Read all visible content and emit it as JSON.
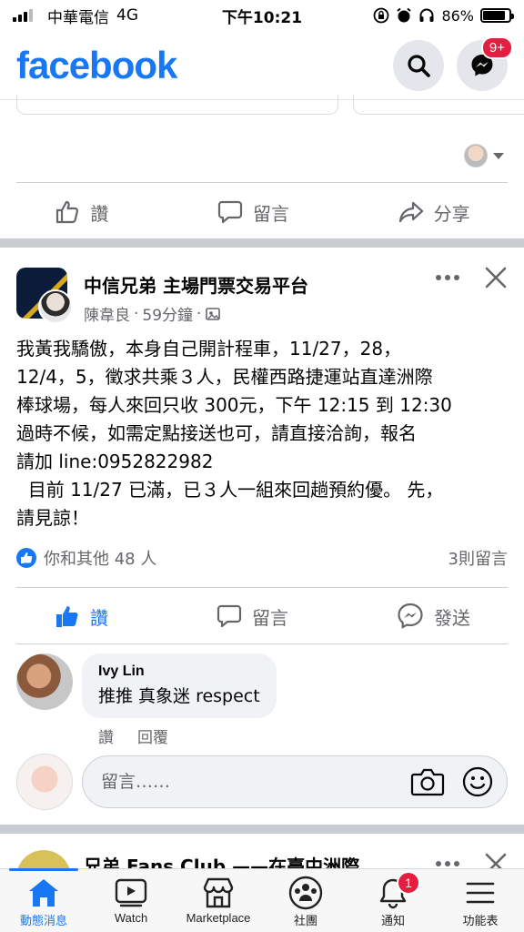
{
  "status_bar": {
    "carrier": "中華電信",
    "network": "4G",
    "time": "下午10:21",
    "battery": "86%",
    "battery_level": 0.86
  },
  "header": {
    "logo": "facebook",
    "messenger_badge": "9+"
  },
  "prev_post": {
    "actions": {
      "like": "讚",
      "comment": "留言",
      "share": "分享"
    }
  },
  "post": {
    "group_name": "中信兄弟 主場門票交易平台",
    "author": "陳韋良",
    "time": "59分鐘",
    "body": "我黃我驕傲，本身自己開計程車，11/27，28，\n12/4，5，徵求共乘３人，民權西路捷運站直達洲際\n棒球場，每人來回只收 300元，下午 12:15 到 12:30\n過時不候，如需定點接送也可，請直接洽詢，報名\n請加 line:0952822982\n  目前 11/27 已滿，已３人一組來回趟預約優。 先，\n請見諒！",
    "reactions": "你和其他 48 人",
    "comment_count": "3則留言",
    "actions": {
      "like": "讚",
      "comment": "留言",
      "send": "發送"
    }
  },
  "comment": {
    "name": "Ivy Lin",
    "text": "推推 真象迷 respect",
    "like": "讚",
    "reply": "回覆"
  },
  "comment_input": {
    "placeholder": "留言……"
  },
  "next_post": {
    "title": "兄弟 Fans Club ——在臺中洲際"
  },
  "tab_bar": {
    "tabs": [
      "動態消息",
      "Watch",
      "Marketplace",
      "社團",
      "通知",
      "功能表"
    ],
    "notification_badge": "1"
  },
  "colors": {
    "brand": "#1877f2",
    "badge": "#e41e3f",
    "separator": "#c9ccd1"
  }
}
